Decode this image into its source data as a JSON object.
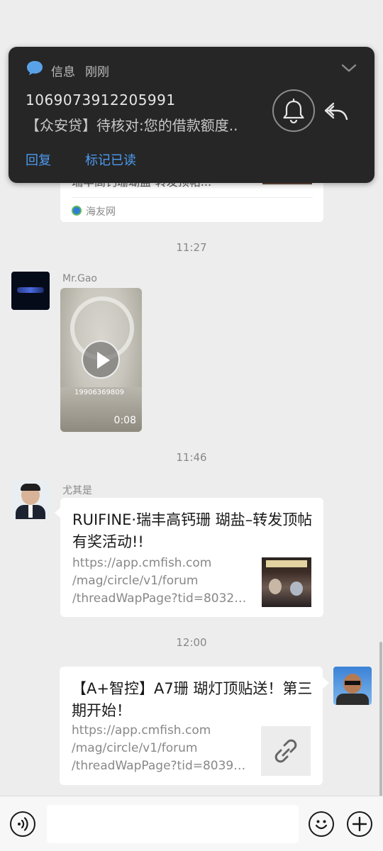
{
  "notification": {
    "app_name": "信息",
    "time": "刚刚",
    "sender": "1069073912205991",
    "preview": "【众安贷】待核对:您的借款额度..",
    "action_reply": "回复",
    "action_mark_read": "标记已读"
  },
  "messages": {
    "top_card": {
      "partial_title": "瑞丰高钙珊瑚盐-转发顶帖...",
      "source": "海友网"
    },
    "time_1": "11:27",
    "video_msg": {
      "sender": "Mr.Gao",
      "duration": "0:08",
      "overlay_text": "19906369809"
    },
    "time_2": "11:46",
    "link_msg_1": {
      "sender": "尤其是",
      "title": "RUIFINE·瑞丰高钙珊 瑚盐–转发顶帖有奖活动!!",
      "url_line1": "https://app.cmfish.com",
      "url_line2": "/mag/circle/v1/forum",
      "url_line3": "/threadWapPage?tid=80322..."
    },
    "time_3": "12:00",
    "link_msg_2": {
      "title": "【A+智控】A7珊 瑚灯顶贴送！第三期开始！",
      "url_line1": "https://app.cmfish.com",
      "url_line2": "/mag/circle/v1/forum",
      "url_line3": "/threadWapPage?tid=80391..."
    }
  },
  "colors": {
    "link_blue": "#4c9bf0",
    "chat_bg": "#ededed",
    "notif_bg": "#262626"
  }
}
